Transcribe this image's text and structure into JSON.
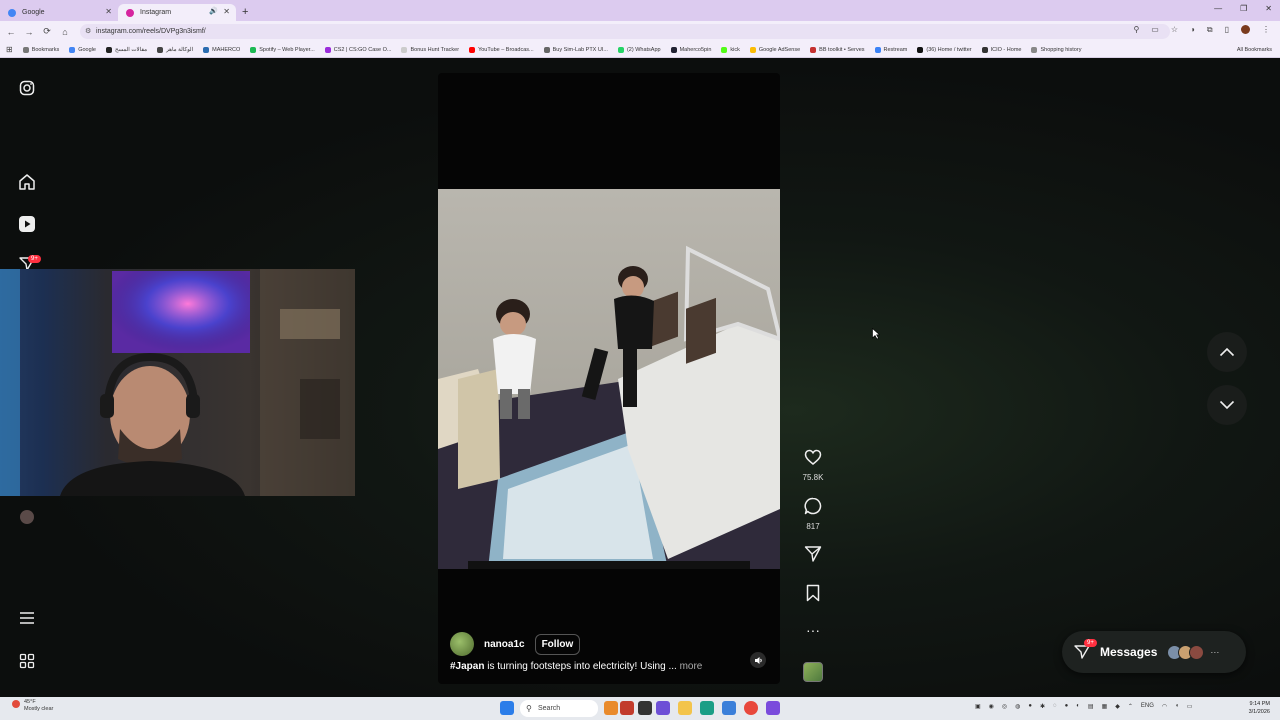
{
  "browser": {
    "tabs": [
      {
        "label": "Google",
        "favicon_color": "#4285f4",
        "active": false
      },
      {
        "label": "Instagram",
        "favicon_color": "#d6249f",
        "active": true
      }
    ],
    "url": "instagram.com/reels/DVPg3n3ismf/",
    "bookmarks": [
      {
        "label": "Bookmarks",
        "color": "#777"
      },
      {
        "label": "Google",
        "color": "#4285f4"
      },
      {
        "label": "مقالات المسح",
        "color": "#222"
      },
      {
        "label": "الوكالة ماهر",
        "color": "#444"
      },
      {
        "label": "MAHERCO",
        "color": "#2b6cb0"
      },
      {
        "label": "Spotify – Web Player...",
        "color": "#1db954"
      },
      {
        "label": "CS2 | CS:GO Case O...",
        "color": "#9b2cdb"
      },
      {
        "label": "Bonus Hunt Tracker",
        "color": "#ccc"
      },
      {
        "label": "YouTube – Broadcas...",
        "color": "#ff0000"
      },
      {
        "label": "Buy Sim-Lab PTX UI...",
        "color": "#666"
      },
      {
        "label": "(2) WhatsApp",
        "color": "#25d366"
      },
      {
        "label": "Maherco5pin",
        "color": "#223"
      },
      {
        "label": "kick",
        "color": "#53fc18"
      },
      {
        "label": "Google AdSense",
        "color": "#fbbc05"
      },
      {
        "label": "BB toolkit • Serves",
        "color": "#c53030"
      },
      {
        "label": "Restream",
        "color": "#3b82f6"
      },
      {
        "label": "(36) Home / twitter",
        "color": "#111"
      },
      {
        "label": "ICIO - Home",
        "color": "#333"
      },
      {
        "label": "Shopping history",
        "color": "#888"
      }
    ],
    "all_bookmarks": "All Bookmarks"
  },
  "sidebar": {
    "notifications_badge": "9+"
  },
  "reel": {
    "username": "nanoa1c",
    "follow_label": "Follow",
    "caption_tag": "#Japan",
    "caption_text": " is turning footsteps into electricity! Using ...",
    "more_label": "more",
    "likes": "75.8K",
    "comments": "817"
  },
  "messages": {
    "label": "Messages",
    "badge": "9+"
  },
  "taskbar": {
    "weather_temp": "45°F",
    "weather_desc": "Mostly clear",
    "search_label": "Search",
    "language": "ENG",
    "time": "9:14 PM",
    "date": "3/1/2026"
  },
  "colors": {
    "like_badge": "#ff3040",
    "page_bg": "#0c0e0d"
  }
}
